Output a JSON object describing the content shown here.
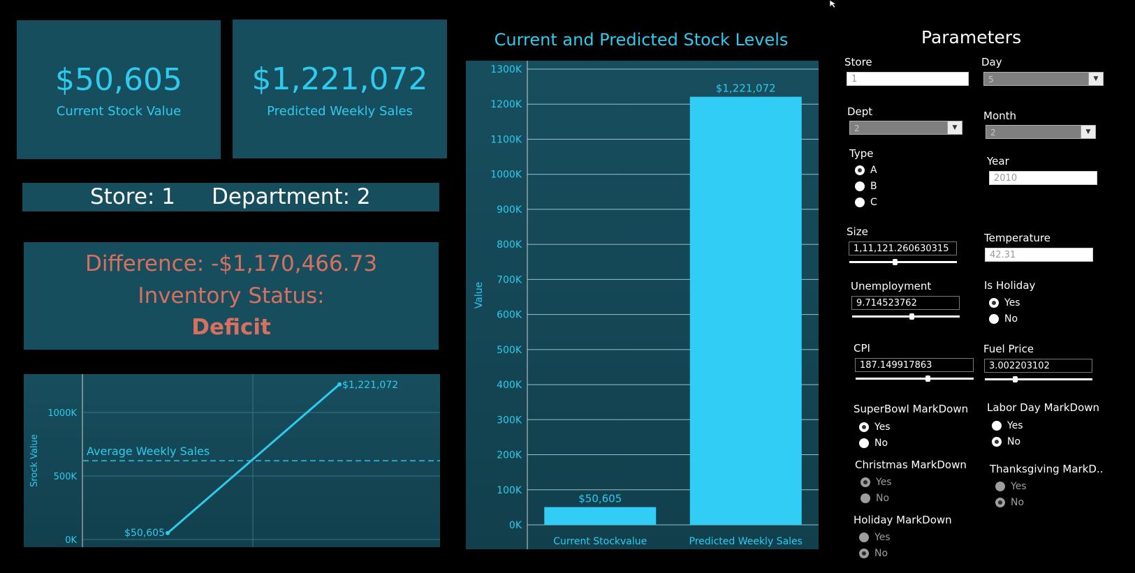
{
  "kpis": {
    "current": {
      "value": "$50,605",
      "label": "Current Stock Value"
    },
    "predicted": {
      "value": "$1,221,072",
      "label": "Predicted Weekly Sales"
    }
  },
  "store_dept": {
    "store": "Store: 1",
    "department": "Department: 2"
  },
  "difference": {
    "line1": "Difference: -$1,170,466.73",
    "line2": "Inventory Status:",
    "status": "Deficit"
  },
  "colors": {
    "accent": "#2ecbef",
    "panel": "#174e5e",
    "deficit": "#d9705f",
    "background": "#000000"
  },
  "chart_data": [
    {
      "type": "line",
      "x": [
        0,
        1
      ],
      "y": [
        50605,
        1221072
      ],
      "data_labels": [
        "$50,605",
        "$1,221,072"
      ],
      "ylabel": "Srock Value",
      "yticks": [
        "0K",
        "500K",
        "1000K"
      ],
      "ylim": [
        0,
        1300000
      ],
      "reference_line": {
        "label": "Average Weekly Sales",
        "value": 620000
      },
      "grid": true
    },
    {
      "type": "bar",
      "title": "Current and Predicted Stock Levels",
      "categories": [
        "Current Stockvalue",
        "Predicted Weekly Sales"
      ],
      "values": [
        50605,
        1221072
      ],
      "data_labels": [
        "$50,605",
        "$1,221,072"
      ],
      "ylabel": "Value",
      "ylim": [
        0,
        1300000
      ],
      "yticks": [
        "0K",
        "100K",
        "200K",
        "300K",
        "400K",
        "500K",
        "600K",
        "700K",
        "800K",
        "900K",
        "1000K",
        "1100K",
        "1200K",
        "1300K"
      ],
      "grid": true
    }
  ],
  "parameters": {
    "title": "Parameters",
    "store": {
      "label": "Store",
      "value": "1"
    },
    "day": {
      "label": "Day",
      "value": "5"
    },
    "dept": {
      "label": "Dept",
      "value": "2"
    },
    "month": {
      "label": "Month",
      "value": "2"
    },
    "type": {
      "label": "Type",
      "options": [
        "A",
        "B",
        "C"
      ],
      "selected": "A"
    },
    "year": {
      "label": "Year",
      "value": "2010"
    },
    "size": {
      "label": "Size",
      "value": "1,11,121.260630315",
      "level": 0.42
    },
    "temperature": {
      "label": "Temperature",
      "value": "42.31"
    },
    "unemployment": {
      "label": "Unemployment",
      "value": "9.714523762",
      "level": 0.55
    },
    "is_holiday": {
      "label": "Is Holiday",
      "yes": "Yes",
      "no": "No",
      "selected": "Yes"
    },
    "cpi": {
      "label": "CPI",
      "value": "187.149917863",
      "level": 0.61
    },
    "fuel_price": {
      "label": "Fuel Price",
      "value": "3.002203102",
      "level": 0.28
    },
    "superbowl": {
      "label": "SuperBowl MarkDown",
      "yes": "Yes",
      "no": "No",
      "selected": "Yes"
    },
    "labor_day": {
      "label": "Labor Day MarkDown",
      "yes": "Yes",
      "no": "No",
      "selected": "No"
    },
    "christmas": {
      "label": "Christmas MarkDown",
      "yes": "Yes",
      "no": "No",
      "selected": "Yes"
    },
    "thanksgiving": {
      "label": "Thanksgiving MarkD..",
      "yes": "Yes",
      "no": "No",
      "selected": "No"
    },
    "holiday": {
      "label": "Holiday MarkDown",
      "yes": "Yes",
      "no": "No",
      "selected": "No"
    }
  }
}
